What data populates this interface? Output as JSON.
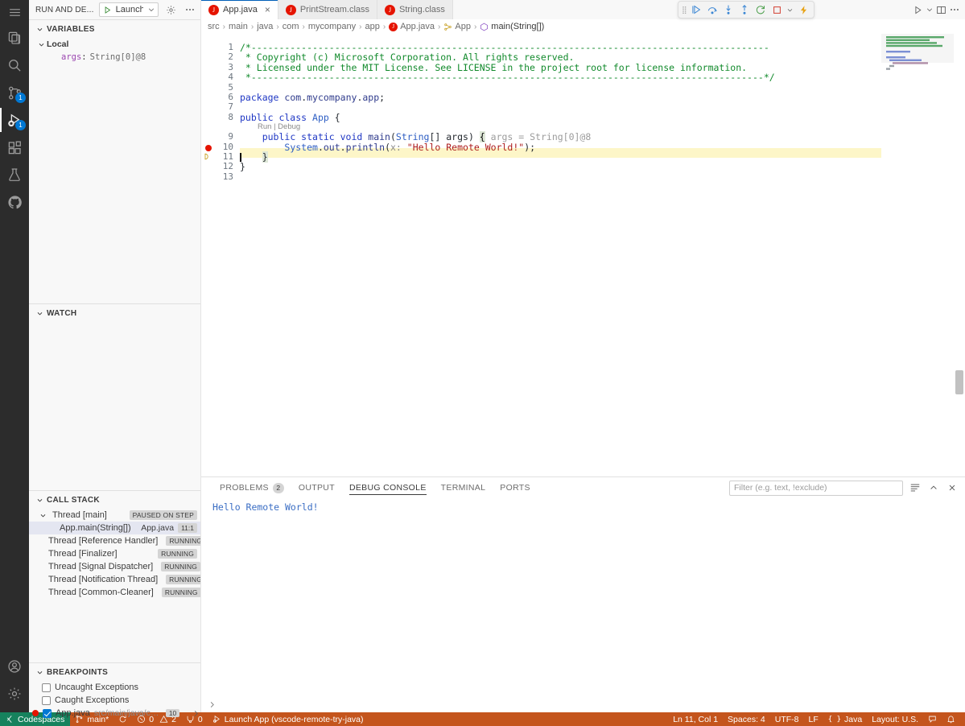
{
  "activity_bar": {
    "items": [
      {
        "name": "menu-icon",
        "label": "Application Menu"
      },
      {
        "name": "explorer-icon",
        "label": "Explorer"
      },
      {
        "name": "search-icon",
        "label": "Search"
      },
      {
        "name": "source-control-icon",
        "label": "Source Control",
        "badge": "1"
      },
      {
        "name": "run-and-debug-icon",
        "label": "Run and Debug",
        "badge": "1",
        "active": true
      },
      {
        "name": "extensions-icon",
        "label": "Extensions"
      },
      {
        "name": "testing-icon",
        "label": "Testing"
      },
      {
        "name": "github-icon",
        "label": "GitHub"
      }
    ],
    "bottom_items": [
      {
        "name": "accounts-icon",
        "label": "Accounts"
      },
      {
        "name": "settings-gear-icon",
        "label": "Manage"
      }
    ]
  },
  "sidebar": {
    "title": "RUN AND DE...",
    "launch_config": "Launch App",
    "sections": {
      "variables": {
        "title": "VARIABLES",
        "scope": "Local",
        "entries": [
          {
            "name": "args",
            "separator": ":",
            "value": "String[0]@8"
          }
        ]
      },
      "watch": {
        "title": "WATCH",
        "entries": []
      },
      "call_stack": {
        "title": "CALL STACK",
        "rows": [
          {
            "label": "Thread [main]",
            "tag": "PAUSED ON STEP",
            "indent": 1,
            "expandable": true
          },
          {
            "label": "App.main(String[])",
            "file": "App.java",
            "position": "11:1",
            "indent": 2,
            "selected": true
          },
          {
            "label": "Thread [Reference Handler]",
            "tag": "RUNNING",
            "indent": 1
          },
          {
            "label": "Thread [Finalizer]",
            "tag": "RUNNING",
            "indent": 1
          },
          {
            "label": "Thread [Signal Dispatcher]",
            "tag": "RUNNING",
            "indent": 1
          },
          {
            "label": "Thread [Notification Thread]",
            "tag": "RUNNING",
            "indent": 1
          },
          {
            "label": "Thread [Common-Cleaner]",
            "tag": "RUNNING",
            "indent": 1
          }
        ]
      },
      "breakpoints": {
        "title": "BREAKPOINTS",
        "rows": [
          {
            "label": "Uncaught Exceptions",
            "checked": false,
            "dot": false
          },
          {
            "label": "Caught Exceptions",
            "checked": false,
            "dot": false
          },
          {
            "label": "App.java",
            "path": "src/main/java/com/myc...",
            "line": "10",
            "checked": true,
            "dot": true
          }
        ]
      }
    }
  },
  "tabs": [
    {
      "label": "App.java",
      "icon": "java-file-icon",
      "active": true,
      "closable": true
    },
    {
      "label": "PrintStream.class",
      "icon": "java-file-icon",
      "active": false
    },
    {
      "label": "String.class",
      "icon": "java-file-icon",
      "active": false
    }
  ],
  "editor_actions": [
    {
      "name": "run-or-debug-icon"
    },
    {
      "name": "chevron-down-icon"
    },
    {
      "name": "split-editor-icon"
    },
    {
      "name": "more-actions-icon"
    }
  ],
  "debug_toolbar": {
    "buttons": [
      {
        "name": "drag-handle-icon"
      },
      {
        "name": "continue-icon",
        "title": "Continue"
      },
      {
        "name": "step-over-icon",
        "title": "Step Over"
      },
      {
        "name": "step-into-icon",
        "title": "Step Into"
      },
      {
        "name": "step-out-icon",
        "title": "Step Out"
      },
      {
        "name": "restart-icon",
        "title": "Restart"
      },
      {
        "name": "stop-icon",
        "title": "Stop"
      },
      {
        "name": "chevron-down-icon",
        "title": "More"
      },
      {
        "name": "hot-reload-icon",
        "title": "Hot Code Replace"
      }
    ]
  },
  "breadcrumb": {
    "items": [
      {
        "label": "src"
      },
      {
        "label": "main"
      },
      {
        "label": "java"
      },
      {
        "label": "com"
      },
      {
        "label": "mycompany"
      },
      {
        "label": "app"
      },
      {
        "label": "App.java",
        "icon": "java-file-icon"
      },
      {
        "label": "App",
        "icon": "class-icon"
      },
      {
        "label": "main(String[])",
        "icon": "method-icon"
      }
    ]
  },
  "code": {
    "lines": [
      {
        "n": "1",
        "text": "/*---------------------------------------------------------------------------------------------"
      },
      {
        "n": "2",
        "text": " * Copyright (c) Microsoft Corporation. All rights reserved."
      },
      {
        "n": "3",
        "text": " * Licensed under the MIT License. See LICENSE in the project root for license information."
      },
      {
        "n": "4",
        "text": " *--------------------------------------------------------------------------------------------*/"
      },
      {
        "n": "5",
        "text": ""
      },
      {
        "n": "6",
        "text": "package com.mycompany.app;"
      },
      {
        "n": "7",
        "text": ""
      },
      {
        "n": "8",
        "text": "public class App {"
      },
      {
        "n": "9",
        "text": "    public static void main(String[] args) { args = String[0]@8"
      },
      {
        "n": "10",
        "text": "        System.out.println(x: \"Hello Remote World!\");",
        "breakpoint": true
      },
      {
        "n": "11",
        "text": "    }",
        "current": true
      },
      {
        "n": "12",
        "text": "}"
      },
      {
        "n": "13",
        "text": ""
      }
    ],
    "codelens": "Run | Debug",
    "inline_value": "args = String[0]@8",
    "param_hint": "x:"
  },
  "panel": {
    "tabs": [
      {
        "label": "PROBLEMS",
        "badge": "2",
        "active": false
      },
      {
        "label": "OUTPUT",
        "active": false
      },
      {
        "label": "DEBUG CONSOLE",
        "active": true
      },
      {
        "label": "TERMINAL",
        "active": false
      },
      {
        "label": "PORTS",
        "active": false
      }
    ],
    "filter_placeholder": "Filter (e.g. text, !exclude)",
    "filter_value": "",
    "actions": [
      {
        "name": "clear-console-icon"
      },
      {
        "name": "maximize-panel-icon"
      },
      {
        "name": "close-panel-icon"
      }
    ],
    "console_output": "Hello Remote World!"
  },
  "status_bar": {
    "left": [
      {
        "name": "remote-indicator",
        "icon": "remote-icon",
        "label": "Codespaces"
      },
      {
        "name": "branch-indicator",
        "icon": "git-branch-icon",
        "label": "main*"
      },
      {
        "name": "sync-indicator",
        "icon": "sync-icon",
        "label": ""
      },
      {
        "name": "problems-indicator",
        "icon": "error-warning-icon",
        "label": "0",
        "label2": "2"
      },
      {
        "name": "ports-indicator",
        "icon": "ports-icon",
        "label": "0"
      },
      {
        "name": "debug-session-indicator",
        "icon": "debug-icon",
        "label": "Launch App (vscode-remote-try-java)"
      }
    ],
    "right": [
      {
        "name": "cursor-position",
        "label": "Ln 11, Col 1"
      },
      {
        "name": "indentation",
        "label": "Spaces: 4"
      },
      {
        "name": "encoding",
        "label": "UTF-8"
      },
      {
        "name": "eol",
        "label": "LF"
      },
      {
        "name": "language-mode",
        "label": "Java",
        "icon": "braces-icon"
      },
      {
        "name": "keyboard-layout",
        "label": "Layout: U.S."
      },
      {
        "name": "feedback-icon",
        "label": ""
      },
      {
        "name": "notifications-icon",
        "label": ""
      }
    ]
  },
  "colors": {
    "accent": "#005fb8",
    "remote_green": "#16825d",
    "status_orange": "#c4551d",
    "breakpoint_red": "#e51400",
    "highlight_yellow": "#fdf6c8"
  }
}
